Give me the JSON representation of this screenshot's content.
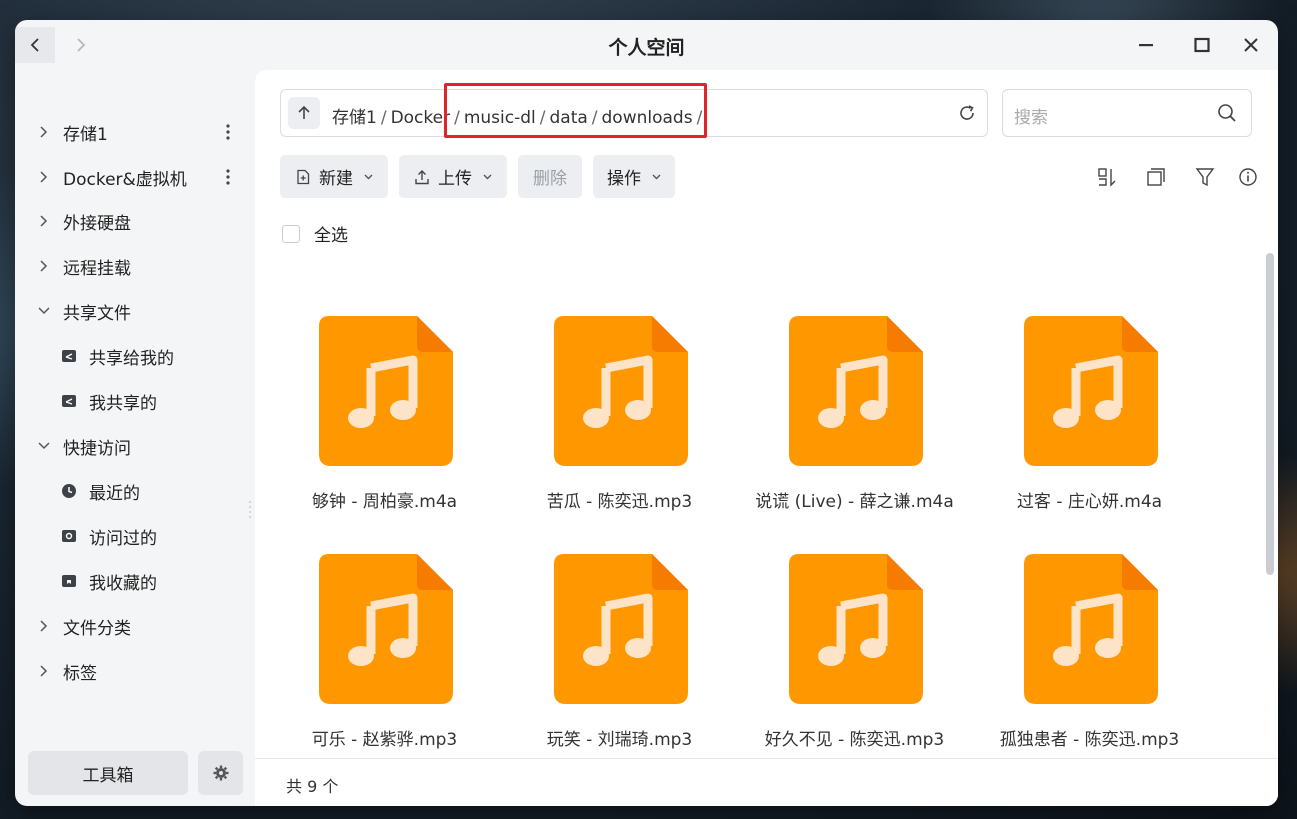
{
  "window": {
    "title": "个人空间"
  },
  "sidebar": {
    "items": [
      {
        "label": "存储1",
        "expanded": false,
        "has_menu": true
      },
      {
        "label": "Docker&虚拟机",
        "expanded": false,
        "has_menu": true
      },
      {
        "label": "外接硬盘",
        "expanded": false
      },
      {
        "label": "远程挂载",
        "expanded": false
      },
      {
        "label": "共享文件",
        "expanded": true
      },
      {
        "label": "共享给我的"
      },
      {
        "label": "我共享的"
      },
      {
        "label": "快捷访问",
        "expanded": true
      },
      {
        "label": "最近的"
      },
      {
        "label": "访问过的"
      },
      {
        "label": "我收藏的"
      },
      {
        "label": "文件分类",
        "expanded": false
      },
      {
        "label": "标签",
        "expanded": false
      }
    ],
    "toolbox_label": "工具箱"
  },
  "path": {
    "crumbs": [
      "存储1",
      "Docker",
      "music-dl",
      "data",
      "downloads"
    ]
  },
  "search": {
    "placeholder": "搜索"
  },
  "toolbar": {
    "new_label": "新建",
    "upload_label": "上传",
    "delete_label": "删除",
    "ops_label": "操作"
  },
  "select_all_label": "全选",
  "files": [
    {
      "name": "够钟 - 周柏豪.m4a",
      "icon": "music-file-icon"
    },
    {
      "name": "苦瓜 - 陈奕迅.mp3",
      "icon": "music-file-icon"
    },
    {
      "name": "说谎 (Live) - 薛之谦.m4a",
      "icon": "music-file-icon"
    },
    {
      "name": "过客 - 庄心妍.m4a",
      "icon": "music-file-icon"
    },
    {
      "name": "可乐 - 赵紫骅.mp3",
      "icon": "music-file-icon"
    },
    {
      "name": "玩笑 - 刘瑞琦.mp3",
      "icon": "music-file-icon"
    },
    {
      "name": "好久不见 - 陈奕迅.mp3",
      "icon": "music-file-icon"
    },
    {
      "name": "孤独患者 - 陈奕迅.mp3",
      "icon": "music-file-icon"
    }
  ],
  "status": {
    "count_label": "共 9 个"
  },
  "colors": {
    "file_icon": "#ff9800",
    "file_icon_fold": "#f57c00",
    "highlight": "#e0242b",
    "note": "#fde3c8"
  }
}
